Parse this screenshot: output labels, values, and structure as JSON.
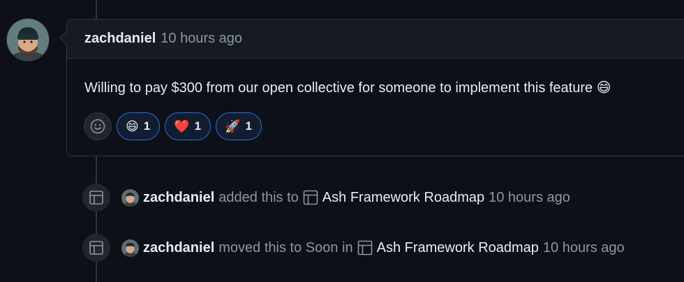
{
  "colors": {
    "background": "#0d1117",
    "border": "#30363d",
    "header_bg": "#161b22",
    "muted_text": "#8d96a0",
    "reaction_border": "#1f6feb"
  },
  "comment": {
    "author": "zachdaniel",
    "timestamp": "10 hours ago",
    "body": "Willing to pay $300 from our open collective for someone to implement this feature 😄",
    "add_reaction_icon": "smiley-icon",
    "reactions": [
      {
        "emoji": "😄",
        "count": "1"
      },
      {
        "emoji": "❤️",
        "count": "1"
      },
      {
        "emoji": "🚀",
        "count": "1"
      }
    ]
  },
  "events": [
    {
      "icon": "table-icon",
      "actor": "zachdaniel",
      "action": "added this to",
      "project_icon": "table-icon",
      "project": "Ash Framework Roadmap",
      "timestamp": "10 hours ago"
    },
    {
      "icon": "table-icon",
      "actor": "zachdaniel",
      "action": "moved this to Soon in",
      "project_icon": "table-icon",
      "project": "Ash Framework Roadmap",
      "timestamp": "10 hours ago"
    }
  ]
}
